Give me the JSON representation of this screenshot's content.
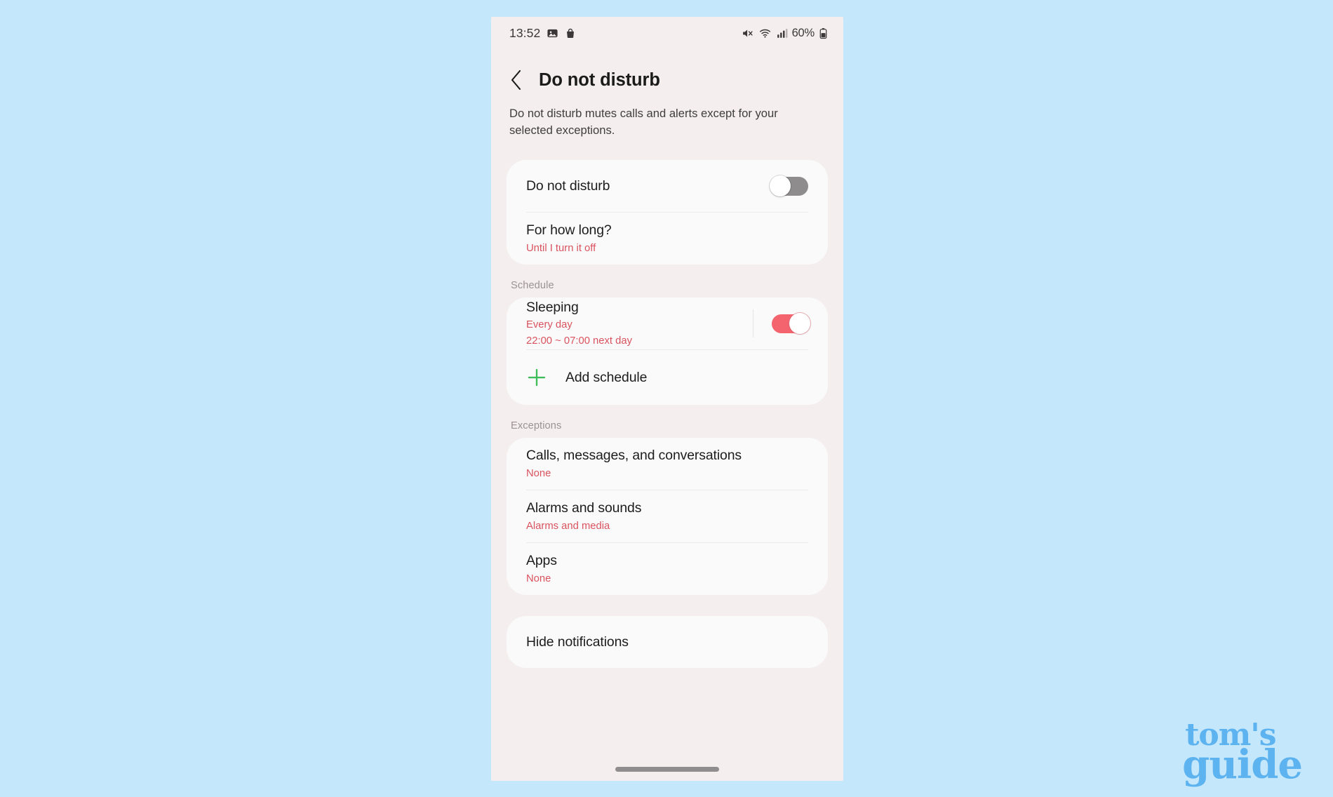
{
  "statusbar": {
    "time": "13:52",
    "icons_left": [
      "image-icon",
      "shopping-bag-icon"
    ],
    "icons_right": [
      "mute-icon",
      "wifi-icon",
      "signal-icon"
    ],
    "battery_percent": "60%",
    "battery_icon": "battery-icon"
  },
  "header": {
    "back_icon": "back-chevron-icon",
    "title": "Do not disturb",
    "subtitle": "Do not disturb mutes calls and alerts except for your selected exceptions."
  },
  "main_card": {
    "dnd_row": {
      "title": "Do not disturb",
      "toggle_state": "off"
    },
    "duration_row": {
      "title": "For how long?",
      "value": "Until I turn it off"
    }
  },
  "schedule": {
    "section_label": "Schedule",
    "sleeping_row": {
      "title": "Sleeping",
      "sub_1": "Every day",
      "sub_2": "22:00 ~ 07:00 next day",
      "toggle_state": "on"
    },
    "add_row": {
      "icon": "plus-icon",
      "label": "Add schedule"
    }
  },
  "exceptions": {
    "section_label": "Exceptions",
    "rows": [
      {
        "title": "Calls, messages, and conversations",
        "value": "None"
      },
      {
        "title": "Alarms and sounds",
        "value": "Alarms and media"
      },
      {
        "title": "Apps",
        "value": "None"
      }
    ]
  },
  "hide_notifications": {
    "title": "Hide notifications"
  },
  "watermark": {
    "line1": "tom's",
    "line2": "guide"
  },
  "colors": {
    "page_background": "#c5e7fb",
    "screen_background": "#f4eeef",
    "card_background": "#fbfafa",
    "accent_red": "#d9535f",
    "toggle_on": "#f4646f",
    "toggle_off": "#8e8c8c",
    "plus_green": "#3ebd5a",
    "watermark_blue": "#5cb3ef"
  }
}
